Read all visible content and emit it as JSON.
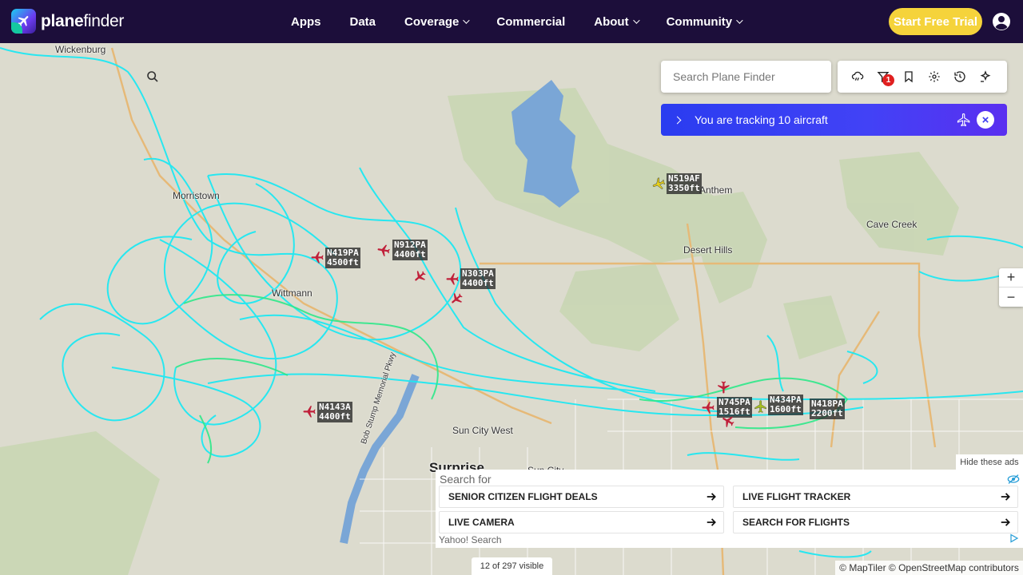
{
  "brand": {
    "name_bold": "plane",
    "name_rest": "finder"
  },
  "nav": {
    "items": [
      {
        "label": "Apps",
        "dropdown": false
      },
      {
        "label": "Data",
        "dropdown": false
      },
      {
        "label": "Coverage",
        "dropdown": true
      },
      {
        "label": "Commercial",
        "dropdown": false
      },
      {
        "label": "About",
        "dropdown": true
      },
      {
        "label": "Community",
        "dropdown": true
      }
    ],
    "trial_label": "Start Free Trial"
  },
  "search": {
    "placeholder": "Search Plane Finder"
  },
  "toolbar": {
    "icons": [
      "weather-icon",
      "filter-icon",
      "bookmark-icon",
      "settings-icon",
      "history-icon",
      "ar-icon"
    ],
    "filter_badge": "1"
  },
  "tracking": {
    "text": "You are tracking 10 aircraft"
  },
  "map": {
    "places": [
      {
        "name": "Wickenburg"
      },
      {
        "name": "Morristown"
      },
      {
        "name": "Wittmann"
      },
      {
        "name": "Anthem"
      },
      {
        "name": "Cave Creek"
      },
      {
        "name": "Desert Hills"
      },
      {
        "name": "Sun City West"
      },
      {
        "name": "Surprise"
      },
      {
        "name": "Sun City"
      },
      {
        "name": "Bob Stump Memorial Pkwy"
      }
    ],
    "aircraft": [
      {
        "callsign": "N519AF",
        "altitude": "3350ft",
        "color": "#e8d21a"
      },
      {
        "callsign": "N419PA",
        "altitude": "4500ft",
        "color": "#c0203a"
      },
      {
        "callsign": "N912PA",
        "altitude": "4400ft",
        "color": "#c0203a"
      },
      {
        "callsign": "N303PA",
        "altitude": "4400ft",
        "color": "#c0203a"
      },
      {
        "callsign": "N4143A",
        "altitude": "4400ft",
        "color": "#c0203a"
      },
      {
        "callsign": "N745PA",
        "altitude": "1516ft",
        "color": "#c0203a"
      },
      {
        "callsign": "N434PA",
        "altitude": "1600ft",
        "color": "#a8c020"
      },
      {
        "callsign": "N418PA",
        "altitude": "2200ft",
        "color": "#c0203a"
      }
    ]
  },
  "zoom": {
    "in": "+",
    "out": "−"
  },
  "ad": {
    "hide_label": "Hide these ads",
    "search_for": "Search for",
    "links": [
      "SENIOR CITIZEN FLIGHT DEALS",
      "LIVE FLIGHT TRACKER",
      "LIVE CAMERA",
      "SEARCH FOR FLIGHTS"
    ],
    "provider": "Yahoo! Search"
  },
  "status": {
    "visible": "12 of 297 visible"
  },
  "attribution": "© MapTiler © OpenStreetMap contributors"
}
